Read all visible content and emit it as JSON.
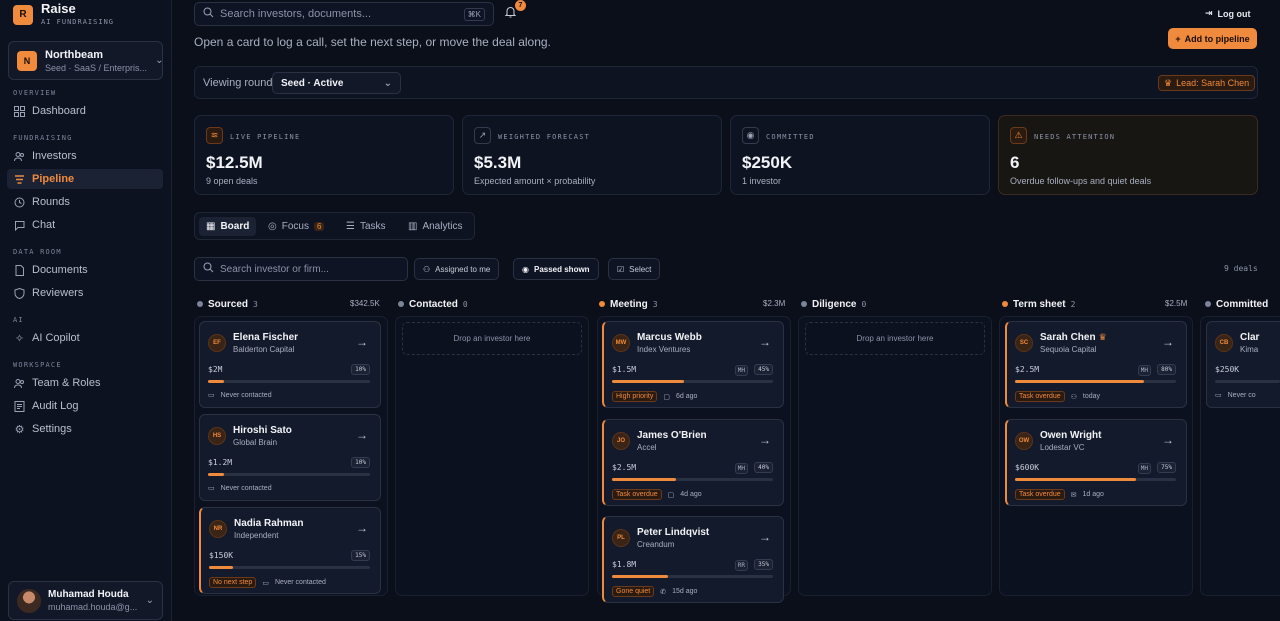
{
  "brand": {
    "logo_letter": "R",
    "name": "Raise",
    "tagline": "AI FUNDRAISING"
  },
  "org": {
    "initial": "N",
    "name": "Northbeam",
    "sub": "Seed · SaaS / Enterpris..."
  },
  "nav": {
    "sections": {
      "overview": "OVERVIEW",
      "fundraising": "FUNDRAISING",
      "data_room": "DATA ROOM",
      "ai": "AI",
      "workspace": "WORKSPACE"
    },
    "items": {
      "dashboard": "Dashboard",
      "investors": "Investors",
      "pipeline": "Pipeline",
      "rounds": "Rounds",
      "chat": "Chat",
      "documents": "Documents",
      "reviewers": "Reviewers",
      "ai_copilot": "AI Copilot",
      "team_roles": "Team & Roles",
      "audit_log": "Audit Log",
      "settings": "Settings"
    },
    "active": "pipeline"
  },
  "user": {
    "name": "Muhamad Houda",
    "email": "muhamad.houda@g..."
  },
  "topbar": {
    "search_placeholder": "Search investors, documents...",
    "shortcut": "⌘K",
    "notification_count": "7",
    "logout": "Log out"
  },
  "header": {
    "subtitle": "Open a card to log a call, set the next step, or move the deal along.",
    "add_button": "Add to pipeline"
  },
  "round": {
    "label": "Viewing round",
    "selected": "Seed · Active",
    "lead": "Lead: Sarah Chen"
  },
  "stats": [
    {
      "label": "LIVE PIPELINE",
      "value": "$12.5M",
      "sub": "9 open deals",
      "icon": "layers-icon"
    },
    {
      "label": "WEIGHTED FORECAST",
      "value": "$5.3M",
      "sub": "Expected amount × probability",
      "icon": "trend-icon"
    },
    {
      "label": "COMMITTED",
      "value": "$250K",
      "sub": "1 investor",
      "icon": "check-circle-icon"
    },
    {
      "label": "NEEDS ATTENTION",
      "value": "6",
      "sub": "Overdue follow-ups and quiet deals",
      "icon": "warning-icon"
    }
  ],
  "views": {
    "board": "Board",
    "focus": "Focus",
    "focus_count": "6",
    "tasks": "Tasks",
    "analytics": "Analytics"
  },
  "filters": {
    "search_placeholder": "Search investor or firm...",
    "assigned": "Assigned to me",
    "passed": "Passed shown",
    "select": "Select",
    "deal_count": "9 deals"
  },
  "columns": [
    {
      "name": "Sourced",
      "count": "3",
      "amount": "$342.5K"
    },
    {
      "name": "Contacted",
      "count": "0",
      "amount": ""
    },
    {
      "name": "Meeting",
      "count": "3",
      "amount": "$2.3M"
    },
    {
      "name": "Diligence",
      "count": "0",
      "amount": ""
    },
    {
      "name": "Term sheet",
      "count": "2",
      "amount": "$2.5M"
    },
    {
      "name": "Committed",
      "count": "",
      "amount": ""
    }
  ],
  "drop_text": "Drop an investor here",
  "cards": {
    "sourced": [
      {
        "initials": "EF",
        "name": "Elena Fischer",
        "firm": "Balderton Capital",
        "amount": "$2M",
        "pct": "10%",
        "progress": 0.1,
        "foot": "Never contacted"
      },
      {
        "initials": "HS",
        "name": "Hiroshi Sato",
        "firm": "Global Brain",
        "amount": "$1.2M",
        "pct": "10%",
        "progress": 0.1,
        "foot": "Never contacted"
      },
      {
        "initials": "NR",
        "name": "Nadia Rahman",
        "firm": "Independent",
        "amount": "$150K",
        "pct": "15%",
        "progress": 0.15,
        "tag": "No next step",
        "foot": "Never contacted"
      }
    ],
    "meeting": [
      {
        "initials": "MW",
        "name": "Marcus Webb",
        "firm": "Index Ventures",
        "amount": "$1.5M",
        "owner": "MH",
        "pct": "45%",
        "progress": 0.45,
        "tag": "High priority",
        "foot": "6d ago"
      },
      {
        "initials": "JO",
        "name": "James O'Brien",
        "firm": "Accel",
        "amount": "$2.5M",
        "owner": "MH",
        "pct": "40%",
        "progress": 0.4,
        "tag": "Task overdue",
        "foot": "4d ago"
      },
      {
        "initials": "PL",
        "name": "Peter Lindqvist",
        "firm": "Creandum",
        "amount": "$1.8M",
        "owner": "RR",
        "pct": "35%",
        "progress": 0.35,
        "tag": "Gone quiet",
        "foot": "15d ago"
      }
    ],
    "term_sheet": [
      {
        "initials": "SC",
        "name": "Sarah Chen",
        "firm": "Sequoia Capital",
        "amount": "$2.5M",
        "owner": "MH",
        "pct": "80%",
        "progress": 0.8,
        "tag": "Task overdue",
        "foot": "today"
      },
      {
        "initials": "OW",
        "name": "Owen Wright",
        "firm": "Lodestar VC",
        "amount": "$600K",
        "owner": "MH",
        "pct": "75%",
        "progress": 0.75,
        "tag": "Task overdue",
        "foot": "1d ago"
      }
    ],
    "committed": [
      {
        "initials": "CB",
        "name": "Clar",
        "firm": "Kima",
        "amount": "$250K",
        "foot": "Never co"
      }
    ]
  },
  "colors": {
    "accent": "#f08a3c",
    "background": "#0b0f1a",
    "card": "#131a2b"
  }
}
